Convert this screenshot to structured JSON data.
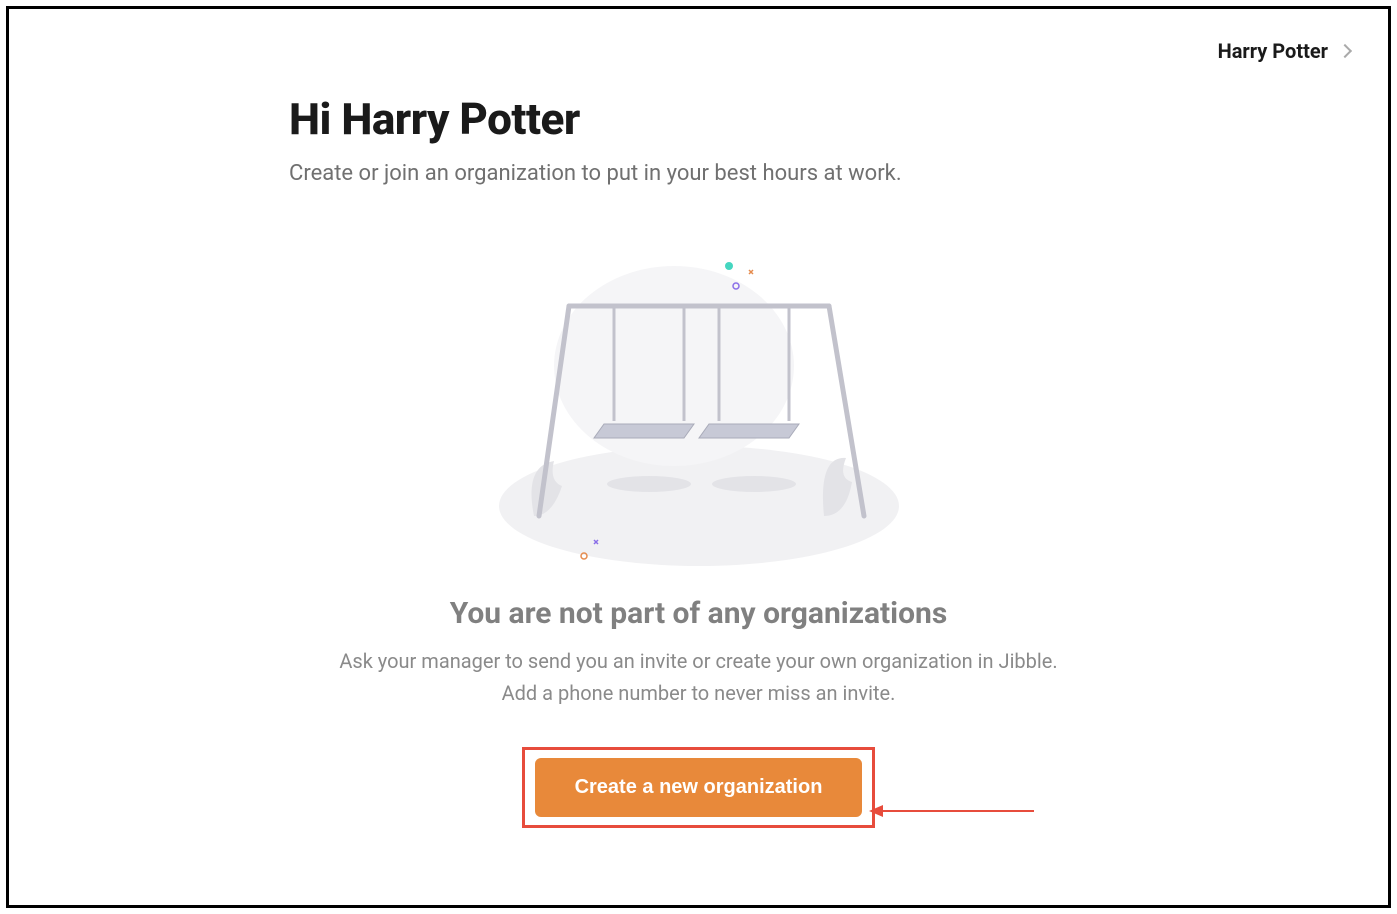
{
  "header": {
    "username": "Harry Potter"
  },
  "main": {
    "greeting": "Hi Harry Potter",
    "subgreeting": "Create or join an organization to put in your best hours at work."
  },
  "emptyState": {
    "title": "You are not part of any organizations",
    "description1": "Ask your manager to send you an invite or create your own organization in Jibble.",
    "description2": "Add a phone number to never miss an invite.",
    "buttonLabel": "Create a new organization"
  }
}
